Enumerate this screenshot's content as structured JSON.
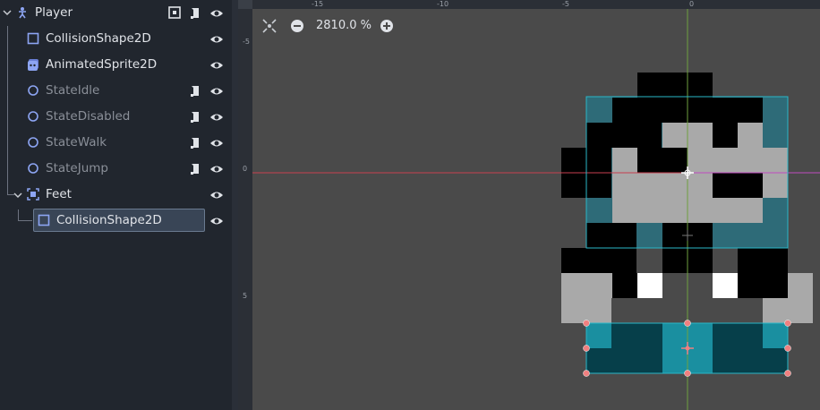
{
  "scene_tree": {
    "nodes": [
      {
        "name": "Player",
        "icon": "character-body-icon",
        "dim": false
      },
      {
        "name": "CollisionShape2D",
        "icon": "collision-shape-icon",
        "dim": false
      },
      {
        "name": "AnimatedSprite2D",
        "icon": "animated-sprite-icon",
        "dim": false
      },
      {
        "name": "StateIdle",
        "icon": "node-circle-icon",
        "dim": true
      },
      {
        "name": "StateDisabled",
        "icon": "node-circle-icon",
        "dim": true
      },
      {
        "name": "StateWalk",
        "icon": "node-circle-icon",
        "dim": true
      },
      {
        "name": "StateJump",
        "icon": "node-circle-icon",
        "dim": true
      },
      {
        "name": "Feet",
        "icon": "area-2d-icon",
        "dim": false
      },
      {
        "name": "CollisionShape2D",
        "icon": "collision-shape-icon",
        "dim": false,
        "selected": true
      }
    ]
  },
  "viewport": {
    "zoom_label": "2810.0 %",
    "ruler_top_labels": [
      "-15",
      "-10",
      "-5",
      "0"
    ],
    "ruler_left_labels": [
      "-5",
      "0",
      "5"
    ]
  },
  "colors": {
    "accent_selection": "#394556",
    "teal": "#2e6b78",
    "teal_light": "#1a8fa0",
    "dark_teal": "#063f4a",
    "sprite_gray": "#a9a9a9",
    "handle": "#f08080"
  }
}
